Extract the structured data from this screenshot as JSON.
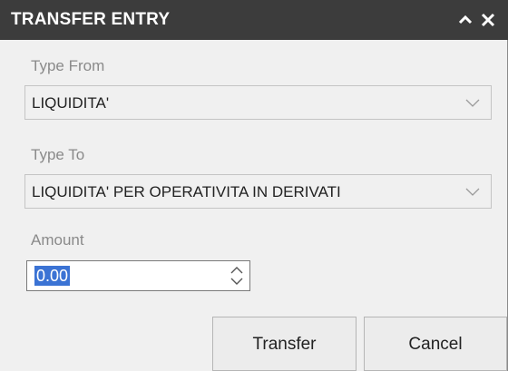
{
  "window": {
    "title": "TRANSFER ENTRY",
    "minimize_icon": "chevron-up-icon",
    "close_icon": "close-icon"
  },
  "type_from": {
    "label": "Type From",
    "value": "LIQUIDITA'"
  },
  "type_to": {
    "label": "Type To",
    "value": "LIQUIDITA' PER OPERATIVITA IN DERIVATI"
  },
  "amount": {
    "label": "Amount",
    "value": "0.00"
  },
  "buttons": {
    "transfer": "Transfer",
    "cancel": "Cancel"
  },
  "colors": {
    "titlebar": "#3c3c3c",
    "selection": "#3b73d4",
    "background": "#f0f0f0"
  }
}
